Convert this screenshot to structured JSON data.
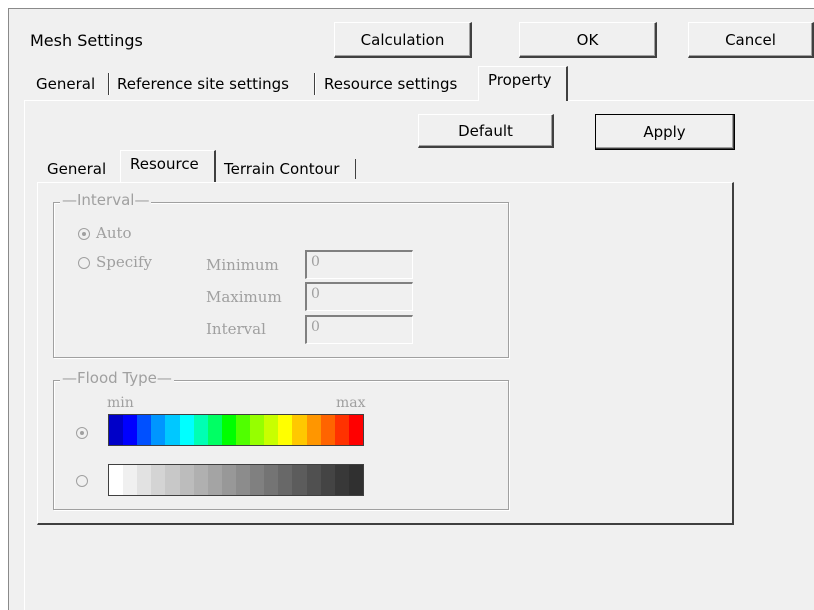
{
  "dialog": {
    "title": "Mesh Settings",
    "buttons": {
      "calculation": "Calculation",
      "ok": "OK",
      "cancel": "Cancel"
    }
  },
  "main_tabs": [
    {
      "label": "General",
      "active": false
    },
    {
      "label": "Reference site settings",
      "active": false
    },
    {
      "label": "Resource settings",
      "active": false
    },
    {
      "label": "Property",
      "active": true
    }
  ],
  "property_page": {
    "buttons": {
      "default": "Default",
      "apply": "Apply"
    },
    "sub_tabs": [
      {
        "label": "General",
        "active": false
      },
      {
        "label": "Resource",
        "active": true
      },
      {
        "label": "Terrain Contour",
        "active": false
      }
    ],
    "interval_group": {
      "legend": "Interval",
      "options": {
        "auto": "Auto",
        "specify": "Specify"
      },
      "selected": "auto",
      "fields": {
        "minimum": {
          "label": "Minimum",
          "value": "0"
        },
        "maximum": {
          "label": "Maximum",
          "value": "0"
        },
        "interval": {
          "label": "Interval",
          "value": "0"
        }
      }
    },
    "flood_type_group": {
      "legend": "Flood Type",
      "min_label": "min",
      "max_label": "max",
      "selected": "color",
      "color_ramp": [
        "#0000c8",
        "#0000ff",
        "#0050ff",
        "#0096ff",
        "#00c8ff",
        "#00ffff",
        "#00ffb4",
        "#00ff64",
        "#00ff00",
        "#50ff00",
        "#96ff00",
        "#c8ff00",
        "#ffff00",
        "#ffc800",
        "#ff9600",
        "#ff6400",
        "#ff3200",
        "#ff0000"
      ],
      "gray_ramp": [
        "#ffffff",
        "#f0f0f0",
        "#e2e2e2",
        "#d4d4d4",
        "#c8c8c8",
        "#bcbcbc",
        "#b0b0b0",
        "#a4a4a4",
        "#989898",
        "#8c8c8c",
        "#808080",
        "#747474",
        "#686868",
        "#5c5c5c",
        "#505050",
        "#444444",
        "#383838",
        "#303030"
      ]
    }
  }
}
